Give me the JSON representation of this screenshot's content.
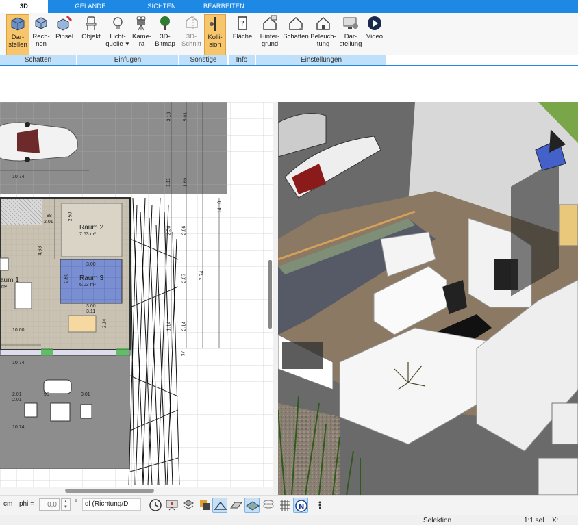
{
  "tabs": [
    {
      "label": "3D",
      "active": true
    },
    {
      "label": "GELÄNDE"
    },
    {
      "label": "SICHTEN"
    },
    {
      "label": "BEARBEITEN"
    }
  ],
  "ribbon": {
    "buttons": [
      {
        "label1": "Dar-",
        "label2": "stellen",
        "icon": "cube-render-icon",
        "active": true
      },
      {
        "label1": "Rech-",
        "label2": "nen",
        "icon": "cube-compute-icon"
      },
      {
        "label1": "Pinsel",
        "label2": "",
        "icon": "brush-cube-icon"
      },
      {
        "label1": "Objekt",
        "label2": "",
        "icon": "chair-icon"
      },
      {
        "label1": "Licht-",
        "label2": "quelle",
        "icon": "lightbulb-icon"
      },
      {
        "label1": "Kame-",
        "label2": "ra",
        "icon": "camera-icon"
      },
      {
        "label1": "3D-",
        "label2": "Bitmap",
        "icon": "tree-icon"
      },
      {
        "label1": "3D-",
        "label2": "Schnitt",
        "icon": "section-icon",
        "disabled": true
      },
      {
        "label1": "Kolli-",
        "label2": "sion",
        "icon": "collision-icon",
        "active": true
      },
      {
        "label1": "Fläche",
        "label2": "",
        "icon": "area-icon"
      },
      {
        "label1": "Hinter-",
        "label2": "grund",
        "icon": "house-background-icon"
      },
      {
        "label1": "Schatten",
        "label2": "",
        "icon": "house-shadow-icon"
      },
      {
        "label1": "Beleuch-",
        "label2": "tung",
        "icon": "house-light-icon"
      },
      {
        "label1": "Dar-",
        "label2": "stellung",
        "icon": "monitor-settings-icon"
      },
      {
        "label1": "Video",
        "label2": "",
        "icon": "play-icon"
      }
    ],
    "groups": [
      "Schatten",
      "Einfügen",
      "Sonstige",
      "Info",
      "Einstellungen"
    ]
  },
  "plan": {
    "rooms": [
      {
        "name": "Raum 2",
        "area": "7.53 m²"
      },
      {
        "name": "Raum 3",
        "area": "6.03 m²"
      },
      {
        "name": "aum 1",
        "area": "m²"
      }
    ],
    "dims": [
      "10.74",
      "10.74",
      "10.74",
      "10.00",
      "4.68",
      "3.00",
      "3.00",
      "2.50",
      "2.50",
      "2.14",
      "3.11",
      "2.01",
      "2.01",
      "3.01",
      "95",
      "88",
      "3.13",
      "5.01",
      "1.11",
      "1.60",
      "2.96",
      "2.07",
      "7.74",
      "14.10",
      "2.14",
      "1.14",
      "37",
      "2.56",
      "2.01"
    ]
  },
  "bottombar": {
    "unit": "cm",
    "phi_label": "phi =",
    "phi_value": "0,0",
    "degree": "°",
    "mode_select": "dl (Richtung/Di"
  },
  "statusbar": {
    "selection": "Selektion",
    "scale": "1:1 sel",
    "x_label": "X:"
  },
  "colors": {
    "accent": "#1e88e5",
    "active_button": "#f7c56b",
    "group_bar": "#bfe0fb"
  }
}
